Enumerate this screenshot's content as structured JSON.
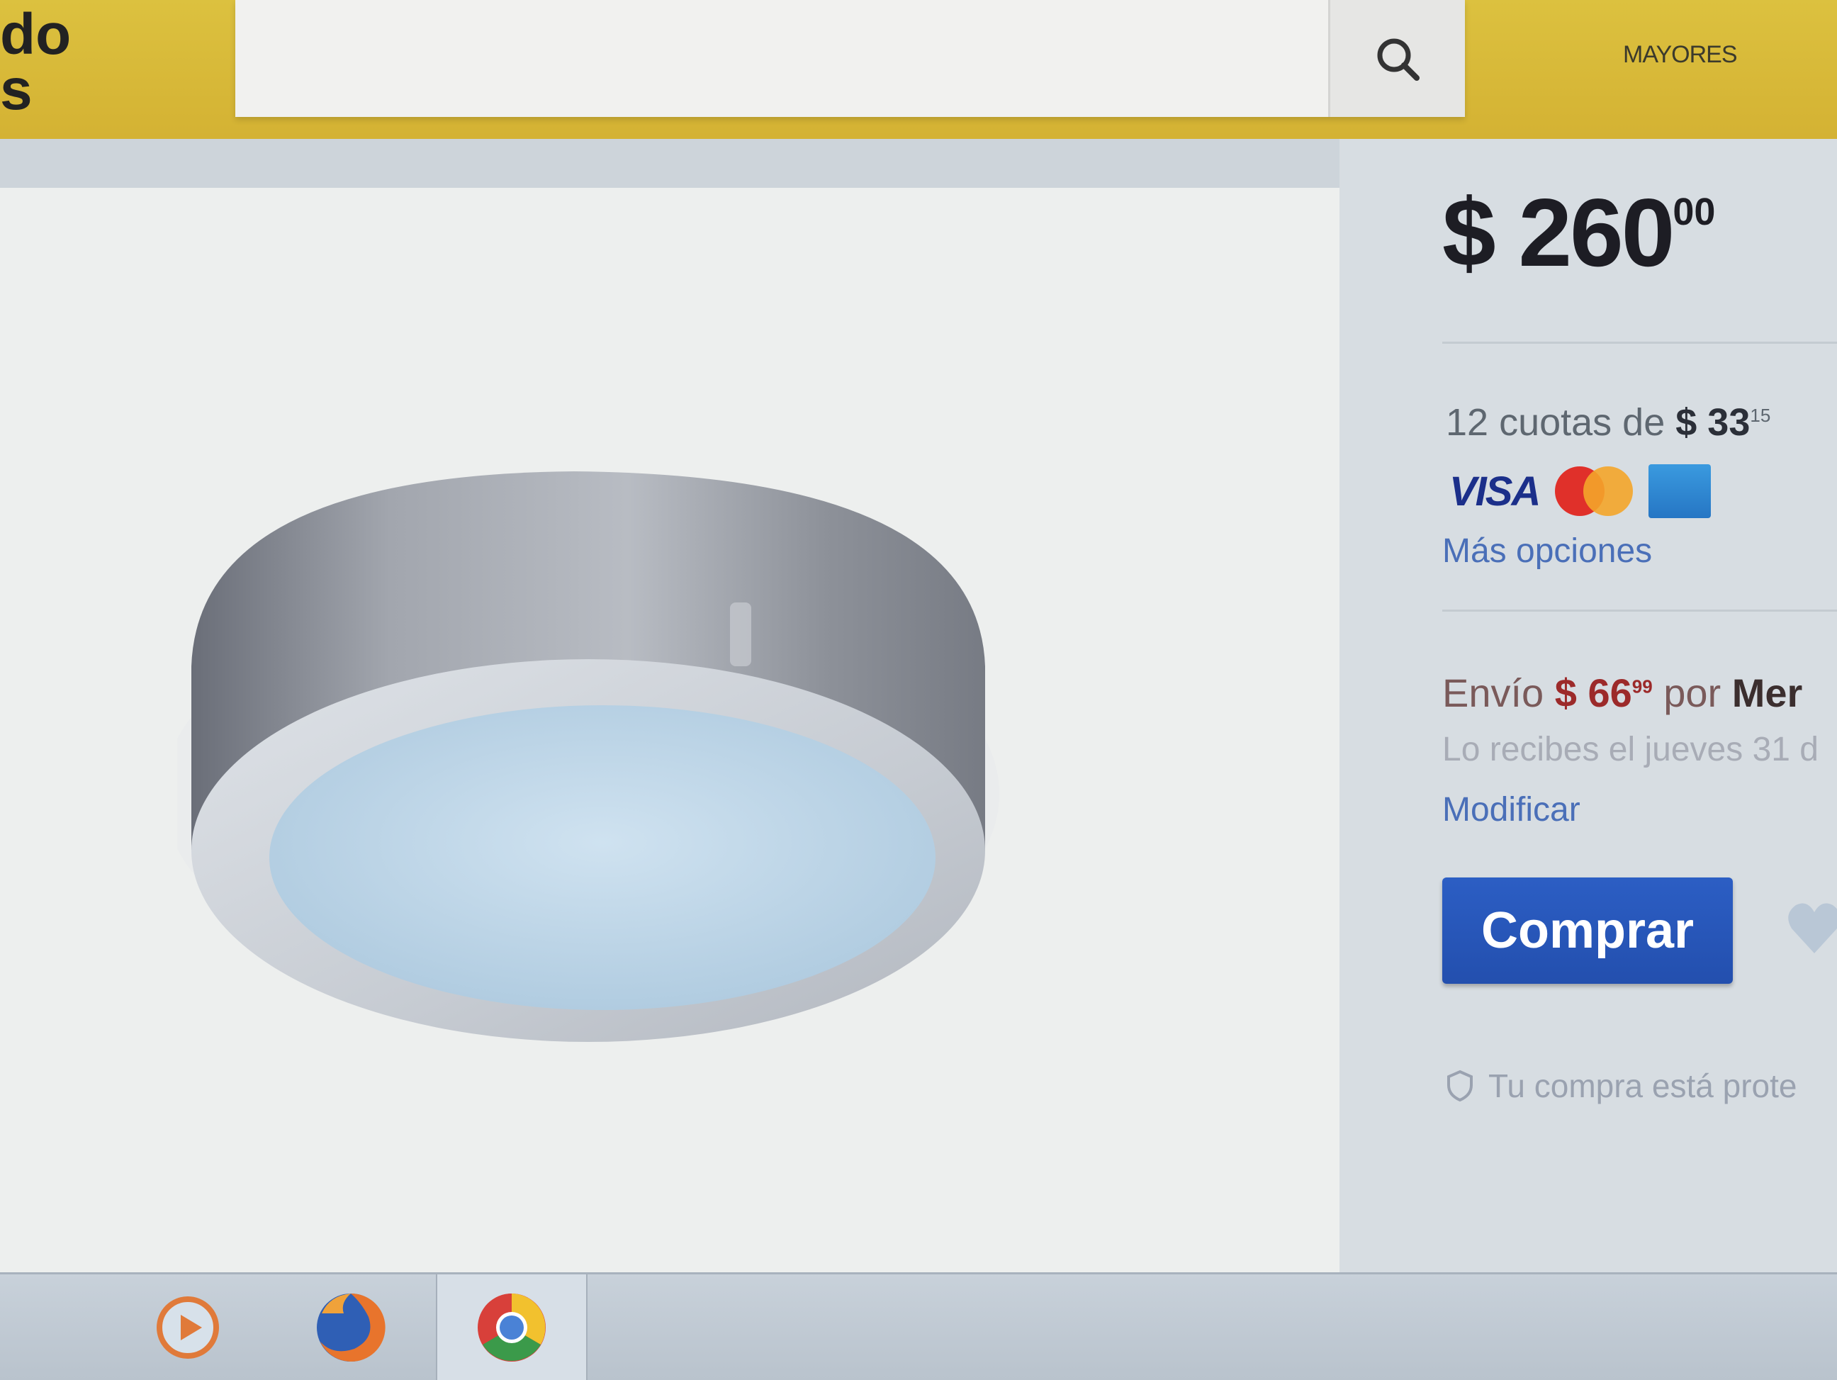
{
  "header": {
    "logo_line1": "do",
    "logo_line2": "s",
    "search_placeholder": "",
    "nav_link": "MAYORES"
  },
  "product": {
    "image_name": "ceiling-light-fixture"
  },
  "buybox": {
    "price_symbol": "$",
    "price_whole": "260",
    "price_cents": "00",
    "installments_prefix": "12 cuotas de",
    "installments_amount": "$ 33",
    "installments_cents": "15",
    "card_visa": "VISA",
    "more_options": "Más opciones",
    "shipping_prefix": "Envío",
    "shipping_amount": "$ 66",
    "shipping_cents": "99",
    "shipping_by": "por",
    "shipping_carrier": "Mer",
    "delivery_text": "Lo recibes el jueves 31 d",
    "modify_link": "Modificar",
    "buy_button": "Comprar",
    "protection_text": "Tu compra está prote"
  },
  "taskbar": {
    "apps": [
      "media-player",
      "firefox",
      "chrome"
    ]
  },
  "colors": {
    "header": "#d4b233",
    "buy_button": "#2557b9",
    "link": "#4a6fb8",
    "shipping_amount": "#9c2a2a"
  }
}
